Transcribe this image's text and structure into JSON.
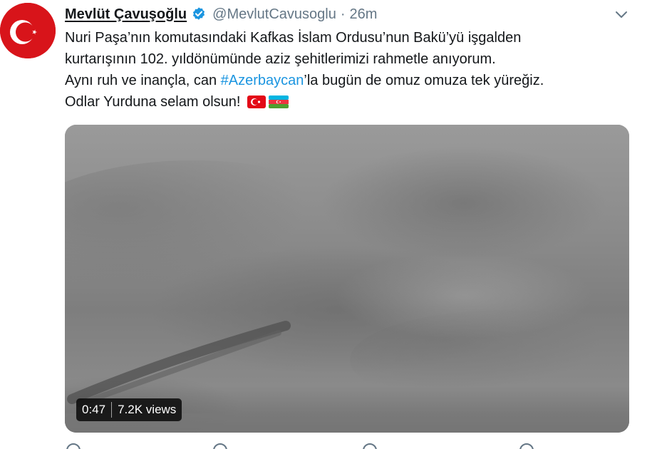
{
  "author": {
    "display_name": "Mevlüt Çavuşoğlu",
    "handle": "@MevlutCavusoglu",
    "separator": "·",
    "time": "26m",
    "verified": true,
    "avatar_icon": "turkish-flag-crescent-star"
  },
  "tweet": {
    "line1": "Nuri Paşa’nın komutasındaki Kafkas İslam Ordusu’nun Bakü’yü işgalden",
    "line2": "kurtarışının 102. yıldönümünde aziz şehitlerimizi rahmetle anıyorum.",
    "line3_before": "Aynı ruh ve inançla, can ",
    "hashtag": "#Azerbaycan",
    "line3_after": "’la bugün de omuz omuza tek yüreğiz.",
    "line4": "Odlar Yurduna selam olsun!",
    "emoji_flags": [
      "flag-turkey",
      "flag-azerbaijan"
    ]
  },
  "media": {
    "duration": "0:47",
    "views": "7.2K views"
  },
  "colors": {
    "accent": "#1b95e0",
    "text": "#14171a",
    "secondary": "#657786",
    "turkey_red": "#e30a17",
    "az_blue": "#00b5e2",
    "az_red": "#ef3340",
    "az_green": "#509e2f"
  },
  "icons": [
    "verified-badge-icon",
    "chevron-down-icon",
    "reply-icon",
    "retweet-icon",
    "like-icon",
    "share-icon"
  ]
}
